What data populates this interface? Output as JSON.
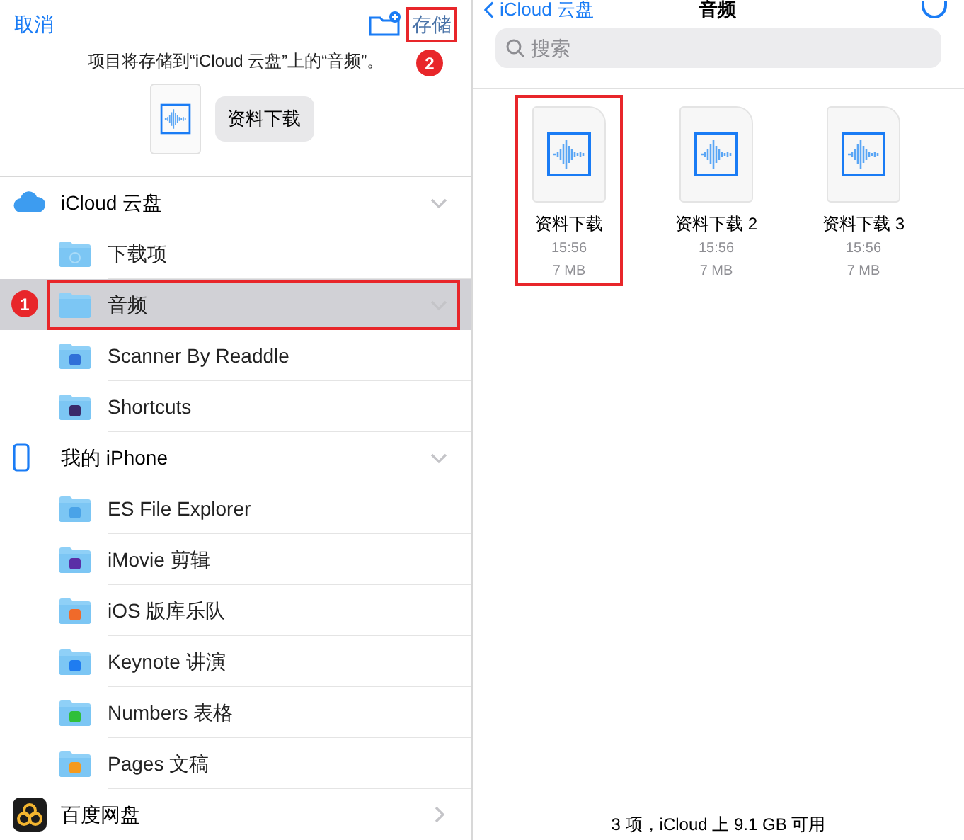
{
  "left": {
    "cancel": "取消",
    "save": {
      "label": "存储",
      "highlighted": true,
      "callout": "2"
    },
    "message": "项目将存储到“iCloud 云盘”上的“音频”。",
    "file_name": "资料下载",
    "locations": [
      {
        "name": "iCloud 云盘",
        "kind": "cloud",
        "expanded": true,
        "children": [
          {
            "name": "下载项",
            "kind": "download",
            "selected": false,
            "highlighted": false
          },
          {
            "name": "音频",
            "kind": "plain",
            "selected": true,
            "highlighted": true,
            "callout": "1",
            "expanded": true
          },
          {
            "name": "Scanner By Readdle",
            "kind": "app",
            "color": "#2f6fd8",
            "selected": false,
            "highlighted": false
          },
          {
            "name": "Shortcuts",
            "kind": "app",
            "color": "#3a2a6a",
            "selected": false,
            "highlighted": false
          }
        ]
      },
      {
        "name": "我的 iPhone",
        "kind": "phone",
        "expanded": true,
        "children": [
          {
            "name": "ES File Explorer",
            "kind": "app",
            "color": "#4aa3e8",
            "selected": false,
            "highlighted": false
          },
          {
            "name": "iMovie 剪辑",
            "kind": "app",
            "color": "#5a2ea6",
            "selected": false,
            "highlighted": false
          },
          {
            "name": "iOS 版库乐队",
            "kind": "app",
            "color": "#f06a2a",
            "selected": false,
            "highlighted": false
          },
          {
            "name": "Keynote 讲演",
            "kind": "app",
            "color": "#1f7cf0",
            "selected": false,
            "highlighted": false
          },
          {
            "name": "Numbers 表格",
            "kind": "app",
            "color": "#2fbf3a",
            "selected": false,
            "highlighted": false
          },
          {
            "name": "Pages 文稿",
            "kind": "app",
            "color": "#f59a1e",
            "selected": false,
            "highlighted": false
          }
        ]
      },
      {
        "name": "百度网盘",
        "kind": "baidu",
        "expanded": false
      }
    ]
  },
  "right": {
    "back": "iCloud 云盘",
    "title": "音频",
    "search": {
      "placeholder": "搜索"
    },
    "files": [
      {
        "name": "资料下载",
        "time": "15:56",
        "size": "7 MB",
        "highlighted": true
      },
      {
        "name": "资料下载 2",
        "time": "15:56",
        "size": "7 MB",
        "highlighted": false
      },
      {
        "name": "资料下载 3",
        "time": "15:56",
        "size": "7 MB",
        "highlighted": false
      }
    ],
    "status": "3 项，iCloud 上 9.1 GB 可用"
  }
}
